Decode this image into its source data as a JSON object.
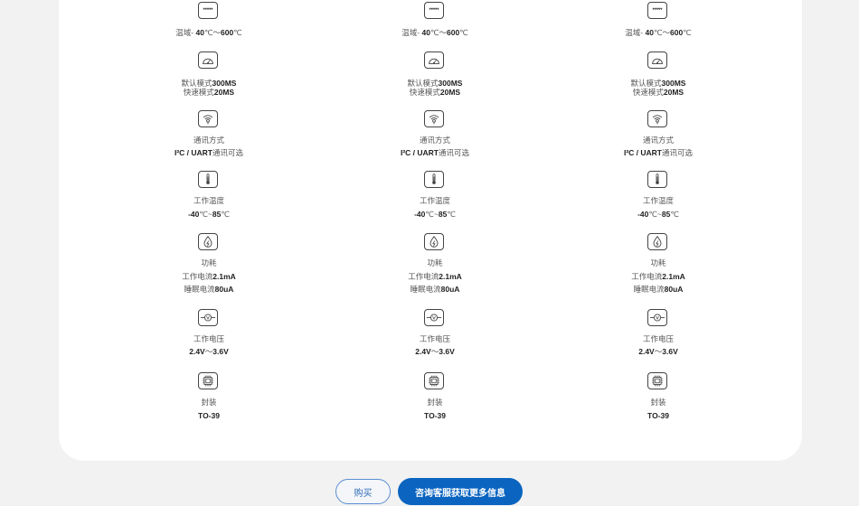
{
  "products": [
    {
      "specs": [
        {
          "icon": "ruler-icon",
          "lines": [
            [
              "温域- ",
              "40",
              "℃～",
              "600",
              "℃"
            ]
          ]
        },
        {
          "icon": "gauge-icon",
          "lines": [
            [
              "默认模式",
              "300MS"
            ],
            [
              "快速模式",
              "20MS"
            ]
          ]
        },
        {
          "icon": "wireless-signal-icon",
          "lines": [
            [
              "通讯方式"
            ],
            [
              "",
              "I²C / UART",
              "通讯可选"
            ]
          ]
        },
        {
          "icon": "thermometer-icon",
          "lines": [
            [
              "工作温度"
            ],
            [
              "",
              "-40",
              "℃~",
              "85",
              "℃"
            ]
          ]
        },
        {
          "icon": "power-drop-icon",
          "lines": [
            [
              "功耗"
            ],
            [
              "工作电流",
              "2.1mA"
            ],
            [
              "睡眠电流",
              "80uA"
            ]
          ]
        },
        {
          "icon": "voltmeter-icon",
          "lines": [
            [
              "工作电压"
            ],
            [
              "",
              "2.4V",
              "～",
              "3.6V"
            ]
          ]
        },
        {
          "icon": "chip-icon",
          "lines": [
            [
              "封装"
            ],
            [
              "",
              "TO-39"
            ]
          ]
        }
      ]
    },
    {
      "specs": [
        {
          "icon": "ruler-icon",
          "lines": [
            [
              "温域- ",
              "40",
              "℃～",
              "600",
              "℃"
            ]
          ]
        },
        {
          "icon": "gauge-icon",
          "lines": [
            [
              "默认模式",
              "300MS"
            ],
            [
              "快速模式",
              "20MS"
            ]
          ]
        },
        {
          "icon": "wireless-signal-icon",
          "lines": [
            [
              "通讯方式"
            ],
            [
              "",
              "I²C / UART",
              "通讯可选"
            ]
          ]
        },
        {
          "icon": "thermometer-icon",
          "lines": [
            [
              "工作温度"
            ],
            [
              "",
              "-40",
              "℃~",
              "85",
              "℃"
            ]
          ]
        },
        {
          "icon": "power-drop-icon",
          "lines": [
            [
              "功耗"
            ],
            [
              "工作电流",
              "2.1mA"
            ],
            [
              "睡眠电流",
              "80uA"
            ]
          ]
        },
        {
          "icon": "voltmeter-icon",
          "lines": [
            [
              "工作电压"
            ],
            [
              "",
              "2.4V",
              "～",
              "3.6V"
            ]
          ]
        },
        {
          "icon": "chip-icon",
          "lines": [
            [
              "封装"
            ],
            [
              "",
              "TO-39"
            ]
          ]
        }
      ]
    },
    {
      "specs": [
        {
          "icon": "ruler-icon",
          "lines": [
            [
              "温域- ",
              "40",
              "℃～",
              "600",
              "℃"
            ]
          ]
        },
        {
          "icon": "gauge-icon",
          "lines": [
            [
              "默认模式",
              "300MS"
            ],
            [
              "快速模式",
              "20MS"
            ]
          ]
        },
        {
          "icon": "wireless-signal-icon",
          "lines": [
            [
              "通讯方式"
            ],
            [
              "",
              "I²C / UART",
              "通讯可选"
            ]
          ]
        },
        {
          "icon": "thermometer-icon",
          "lines": [
            [
              "工作温度"
            ],
            [
              "",
              "-40",
              "℃~",
              "85",
              "℃"
            ]
          ]
        },
        {
          "icon": "power-drop-icon",
          "lines": [
            [
              "功耗"
            ],
            [
              "工作电流",
              "2.1mA"
            ],
            [
              "睡眠电流",
              "80uA"
            ]
          ]
        },
        {
          "icon": "voltmeter-icon",
          "lines": [
            [
              "工作电压"
            ],
            [
              "",
              "2.4V",
              "～",
              "3.6V"
            ]
          ]
        },
        {
          "icon": "chip-icon",
          "lines": [
            [
              "封装"
            ],
            [
              "",
              "TO-39"
            ]
          ]
        }
      ]
    }
  ],
  "actions": {
    "buy_label": "购买",
    "consult_label": "咨询客服获取更多信息"
  },
  "colors": {
    "primary": "#0a64c0",
    "page_background": "#f2f2f2",
    "card_background": "#ffffff"
  }
}
